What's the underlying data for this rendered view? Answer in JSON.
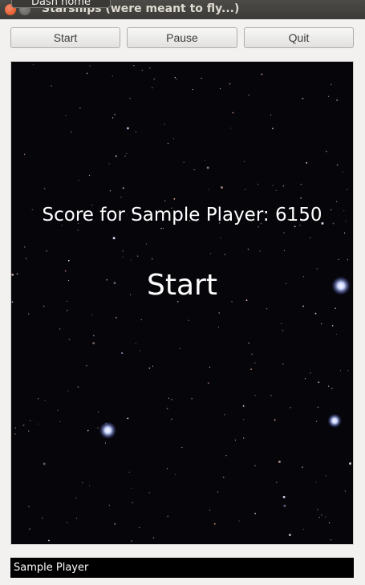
{
  "window": {
    "title": "Starships (were meant to fly...)",
    "tooltip": "Dash home"
  },
  "toolbar": {
    "start_label": "Start",
    "pause_label": "Pause",
    "quit_label": "Quit"
  },
  "game": {
    "score_text": "Score for Sample Player: 6150",
    "start_text": "Start"
  },
  "player": {
    "name": "Sample Player"
  },
  "colors": {
    "canvas_background": "#06050a",
    "text": "#ffffff",
    "close_button": "#df4a16"
  }
}
